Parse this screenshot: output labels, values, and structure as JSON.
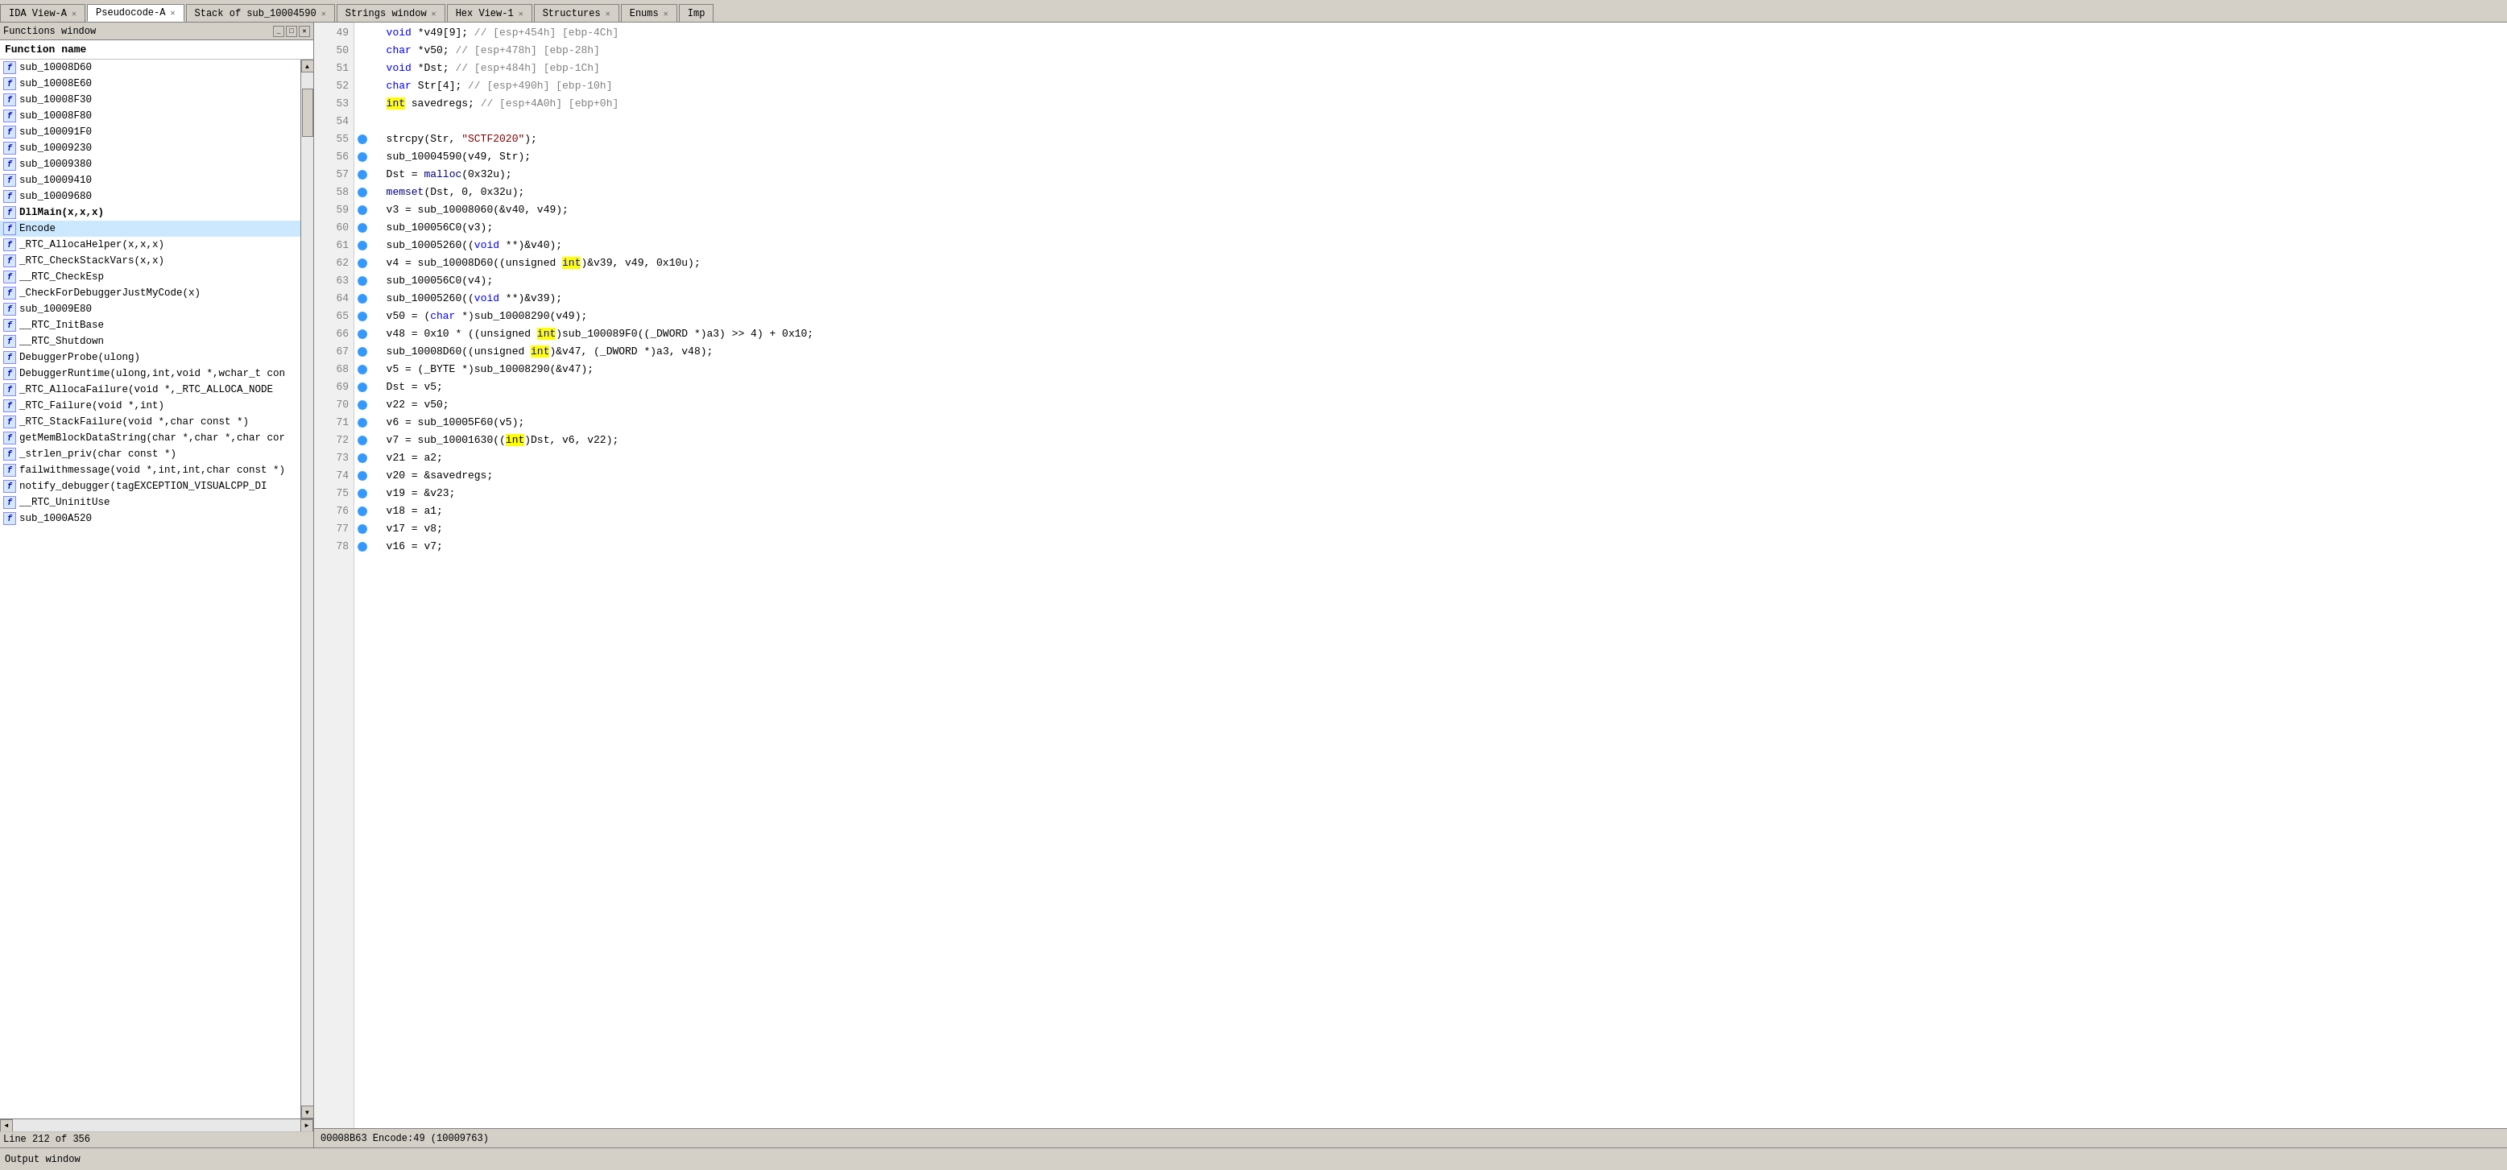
{
  "tabs": [
    {
      "id": "ida-view",
      "label": "IDA View-A",
      "active": false,
      "closable": true
    },
    {
      "id": "pseudocode",
      "label": "Pseudocode-A",
      "active": true,
      "closable": true
    },
    {
      "id": "stack",
      "label": "Stack of sub_10004590",
      "active": false,
      "closable": true
    },
    {
      "id": "strings",
      "label": "Strings window",
      "active": false,
      "closable": true
    },
    {
      "id": "hex-view",
      "label": "Hex View-1",
      "active": false,
      "closable": true
    },
    {
      "id": "structures",
      "label": "Structures",
      "active": false,
      "closable": true
    },
    {
      "id": "enums",
      "label": "Enums",
      "active": false,
      "closable": true
    },
    {
      "id": "imports",
      "label": "Imp",
      "active": false,
      "closable": false
    }
  ],
  "functions_panel": {
    "title": "Functions window",
    "header": "Function name",
    "items": [
      {
        "name": "sub_10008D60",
        "bold": false
      },
      {
        "name": "sub_10008E60",
        "bold": false
      },
      {
        "name": "sub_10008F30",
        "bold": false
      },
      {
        "name": "sub_10008F80",
        "bold": false
      },
      {
        "name": "sub_100091F0",
        "bold": false
      },
      {
        "name": "sub_10009230",
        "bold": false
      },
      {
        "name": "sub_10009380",
        "bold": false
      },
      {
        "name": "sub_10009410",
        "bold": false
      },
      {
        "name": "sub_10009680",
        "bold": false
      },
      {
        "name": "DllMain(x,x,x)",
        "bold": true
      },
      {
        "name": "Encode",
        "bold": false
      },
      {
        "name": "_RTC_AllocaHelper(x,x,x)",
        "bold": false
      },
      {
        "name": "_RTC_CheckStackVars(x,x)",
        "bold": false
      },
      {
        "name": "__RTC_CheckEsp",
        "bold": false
      },
      {
        "name": "_CheckForDebuggerJustMyCode(x)",
        "bold": false
      },
      {
        "name": "sub_10009E80",
        "bold": false
      },
      {
        "name": "__RTC_InitBase",
        "bold": false
      },
      {
        "name": "__RTC_Shutdown",
        "bold": false
      },
      {
        "name": "DebuggerProbe(ulong)",
        "bold": false
      },
      {
        "name": "DebuggerRuntime(ulong,int,void *,wchar_t con",
        "bold": false
      },
      {
        "name": "_RTC_AllocaFailure(void *,_RTC_ALLOCA_NODE",
        "bold": false
      },
      {
        "name": "_RTC_Failure(void *,int)",
        "bold": false
      },
      {
        "name": "_RTC_StackFailure(void *,char const *)",
        "bold": false
      },
      {
        "name": "getMemBlockDataString(char *,char *,char cor",
        "bold": false
      },
      {
        "name": "_strlen_priv(char const *)",
        "bold": false
      },
      {
        "name": "failwithmessage(void *,int,int,char const *)",
        "bold": false
      },
      {
        "name": "notify_debugger(tagEXCEPTION_VISUALCPP_DI",
        "bold": false
      },
      {
        "name": "__RTC_UninitUse",
        "bold": false
      },
      {
        "name": "sub_1000A520",
        "bold": false
      }
    ],
    "status": "Line 212 of 356"
  },
  "code": {
    "status": "00008B63 Encode:49  (10009763)",
    "lines": [
      {
        "num": 49,
        "bp": false,
        "content": "void *v49[9]; // [esp+454h] [ebp-4Ch]",
        "type": "comment"
      },
      {
        "num": 50,
        "bp": false,
        "content": "char *v50; // [esp+478h] [ebp-28h]",
        "type": "comment"
      },
      {
        "num": 51,
        "bp": false,
        "content": "void *Dst; // [esp+484h] [ebp-1Ch]",
        "type": "comment"
      },
      {
        "num": 52,
        "bp": false,
        "content": "char Str[4]; // [esp+490h] [ebp-10h]",
        "type": "comment"
      },
      {
        "num": 53,
        "bp": false,
        "content": "int savedregs; // [esp+4A0h] [ebp+0h]",
        "type": "kw_comment"
      },
      {
        "num": 54,
        "bp": false,
        "content": "",
        "type": "empty"
      },
      {
        "num": 55,
        "bp": true,
        "content": "strcpy(Str, \"SCTF2020\");",
        "type": "code"
      },
      {
        "num": 56,
        "bp": true,
        "content": "sub_10004590(v49, Str);",
        "type": "code"
      },
      {
        "num": 57,
        "bp": true,
        "content": "Dst = malloc(0x32u);",
        "type": "code"
      },
      {
        "num": 58,
        "bp": true,
        "content": "memset(Dst, 0, 0x32u);",
        "type": "code"
      },
      {
        "num": 59,
        "bp": true,
        "content": "v3 = sub_10008060(&v40, v49);",
        "type": "code"
      },
      {
        "num": 60,
        "bp": true,
        "content": "sub_100056C0(v3);",
        "type": "code"
      },
      {
        "num": 61,
        "bp": true,
        "content": "sub_10005260((void **)&v40);",
        "type": "code"
      },
      {
        "num": 62,
        "bp": true,
        "content": "v4 = sub_10008D60((unsigned int)&v39, v49, 0x10u);",
        "type": "code_int"
      },
      {
        "num": 63,
        "bp": true,
        "content": "sub_100056C0(v4);",
        "type": "code"
      },
      {
        "num": 64,
        "bp": true,
        "content": "sub_10005260((void **)&v39);",
        "type": "code"
      },
      {
        "num": 65,
        "bp": true,
        "content": "v50 = (char *)sub_10008290(v49);",
        "type": "code"
      },
      {
        "num": 66,
        "bp": true,
        "content": "v48 = 0x10 * ((unsigned int)sub_100089F0((_DWORD *)a3) >> 4) + 0x10;",
        "type": "code_int"
      },
      {
        "num": 67,
        "bp": true,
        "content": "sub_10008D60((unsigned int)&v47, (_DWORD *)a3, v48);",
        "type": "code_int"
      },
      {
        "num": 68,
        "bp": true,
        "content": "v5 = (_BYTE *)sub_10008290(&v47);",
        "type": "code"
      },
      {
        "num": 69,
        "bp": true,
        "content": "Dst = v5;",
        "type": "code"
      },
      {
        "num": 70,
        "bp": true,
        "content": "v22 = v50;",
        "type": "code"
      },
      {
        "num": 71,
        "bp": true,
        "content": "v6 = sub_10005F60(v5);",
        "type": "code"
      },
      {
        "num": 72,
        "bp": true,
        "content": "v7 = sub_10001630((int)Dst, v6, v22);",
        "type": "code_int2"
      },
      {
        "num": 73,
        "bp": true,
        "content": "v21 = a2;",
        "type": "code"
      },
      {
        "num": 74,
        "bp": true,
        "content": "v20 = &savedregs;",
        "type": "code"
      },
      {
        "num": 75,
        "bp": true,
        "content": "v19 = &v23;",
        "type": "code"
      },
      {
        "num": 76,
        "bp": true,
        "content": "v18 = a1;",
        "type": "code"
      },
      {
        "num": 77,
        "bp": true,
        "content": "v17 = v8;",
        "type": "code"
      },
      {
        "num": 78,
        "bp": true,
        "content": "v16 = v7;",
        "type": "code"
      }
    ]
  },
  "output_panel": {
    "title": "Output window"
  }
}
